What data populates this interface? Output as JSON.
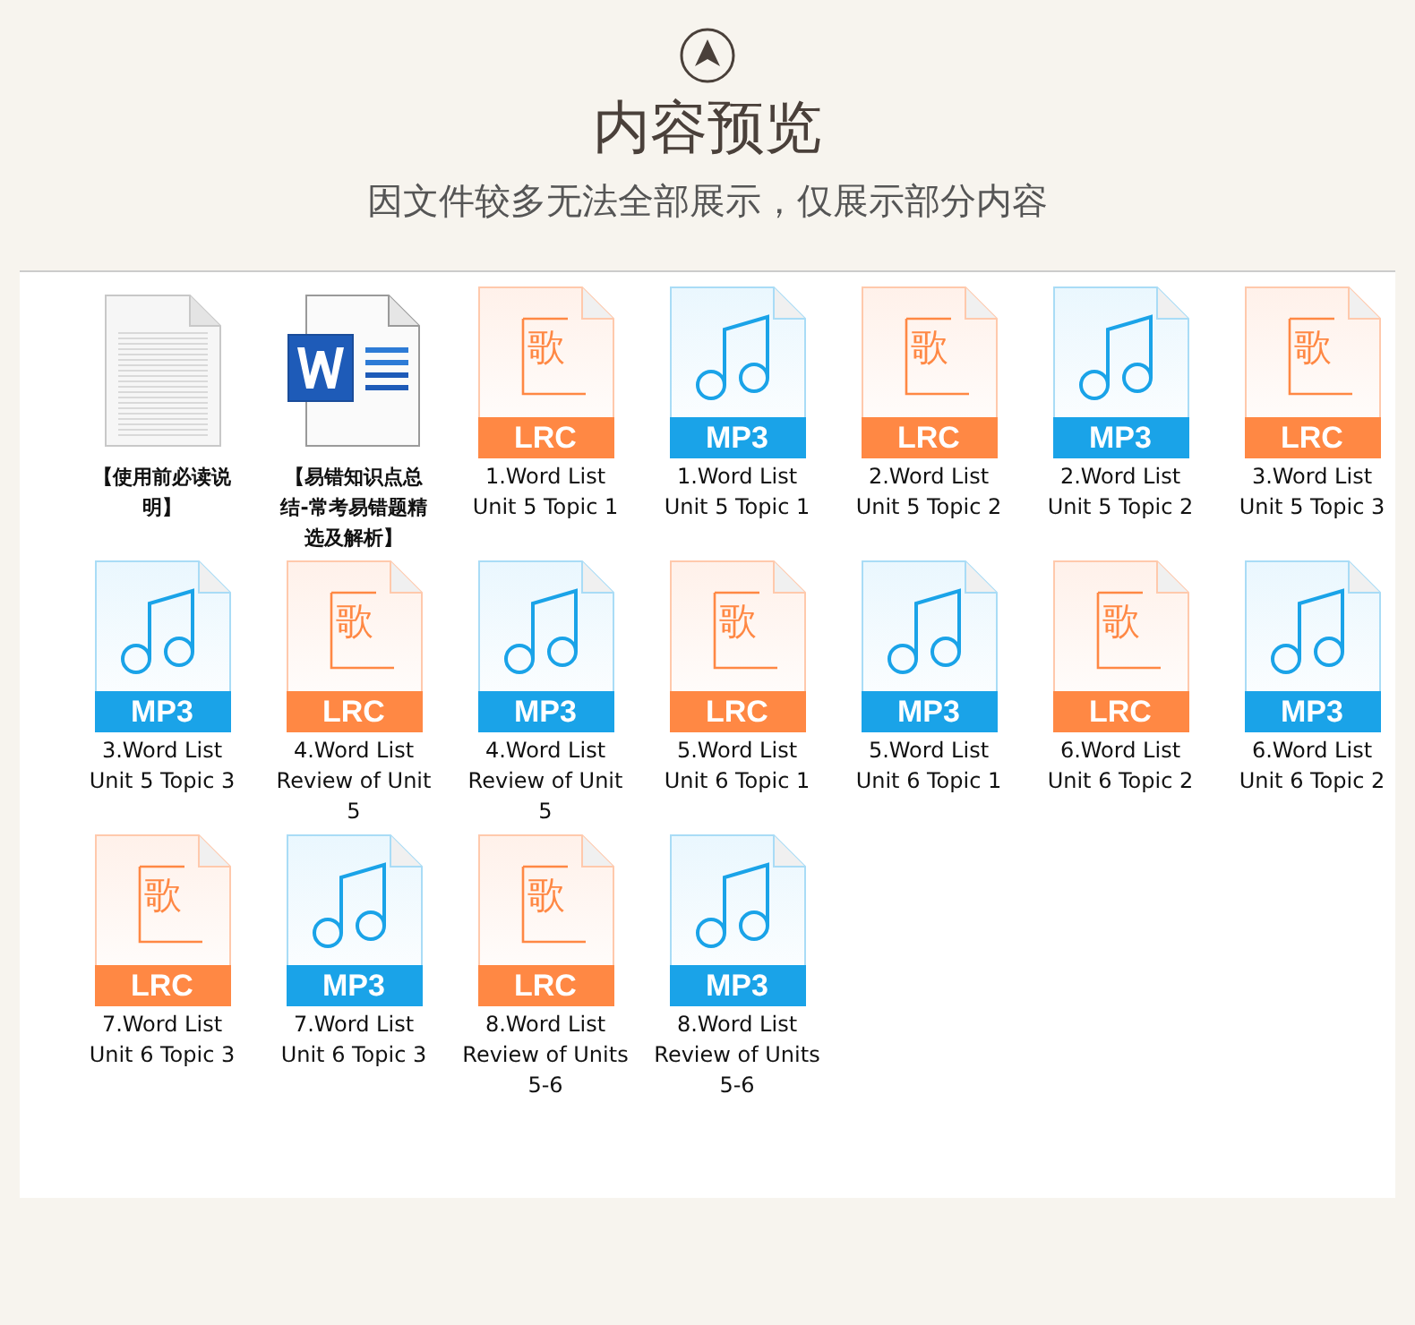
{
  "header": {
    "title": "内容预览",
    "subtitle": "因文件较多无法全部展示，仅展示部分内容"
  },
  "files": [
    {
      "kind": "txt",
      "name": "【使用前必读说明】"
    },
    {
      "kind": "doc",
      "name": "【易错知识点总结-常考易错题精选及解析】"
    },
    {
      "kind": "lrc",
      "glyph": "歌",
      "badge": "LRC",
      "name": "1.Word List\nUnit 5 Topic 1"
    },
    {
      "kind": "mp3",
      "badge": "MP3",
      "name": "1.Word List\nUnit 5 Topic 1"
    },
    {
      "kind": "lrc",
      "glyph": "歌",
      "badge": "LRC",
      "name": "2.Word List\nUnit 5 Topic 2"
    },
    {
      "kind": "mp3",
      "badge": "MP3",
      "name": "2.Word List\nUnit 5 Topic 2"
    },
    {
      "kind": "lrc",
      "glyph": "歌",
      "badge": "LRC",
      "name": "3.Word List\nUnit 5 Topic 3"
    },
    {
      "kind": "mp3",
      "badge": "MP3",
      "name": "3.Word List\nUnit 5 Topic 3"
    },
    {
      "kind": "lrc",
      "glyph": "歌",
      "badge": "LRC",
      "name": "4.Word List\nReview of Unit\n5"
    },
    {
      "kind": "mp3",
      "badge": "MP3",
      "name": "4.Word List\nReview of Unit\n5"
    },
    {
      "kind": "lrc",
      "glyph": "歌",
      "badge": "LRC",
      "name": "5.Word List\nUnit 6 Topic 1"
    },
    {
      "kind": "mp3",
      "badge": "MP3",
      "name": "5.Word List\nUnit 6 Topic 1"
    },
    {
      "kind": "lrc",
      "glyph": "歌",
      "badge": "LRC",
      "name": "6.Word List\nUnit 6 Topic 2"
    },
    {
      "kind": "mp3",
      "badge": "MP3",
      "name": "6.Word List\nUnit 6 Topic 2"
    },
    {
      "kind": "lrc",
      "glyph": "歌",
      "badge": "LRC",
      "name": "7.Word List\nUnit 6 Topic 3"
    },
    {
      "kind": "mp3",
      "badge": "MP3",
      "name": "7.Word List\nUnit 6 Topic 3"
    },
    {
      "kind": "lrc",
      "glyph": "歌",
      "badge": "LRC",
      "name": "8.Word List\nReview of Units\n5-6"
    },
    {
      "kind": "mp3",
      "badge": "MP3",
      "name": "8.Word List\nReview of Units\n5-6"
    }
  ]
}
